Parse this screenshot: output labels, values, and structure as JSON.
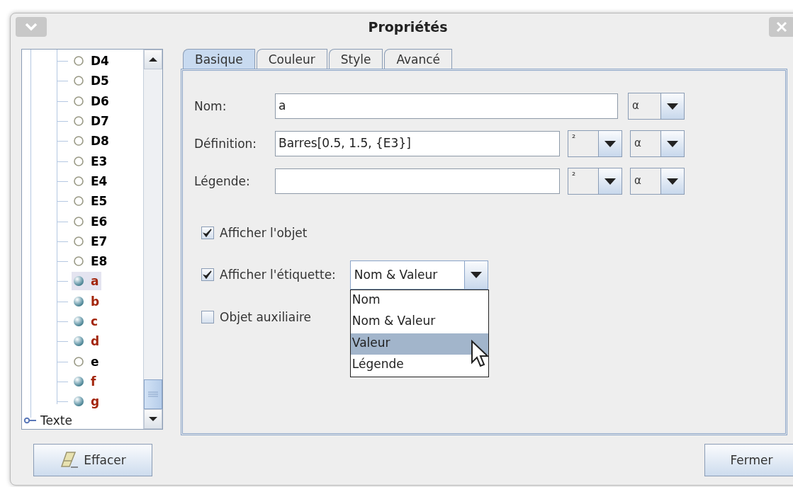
{
  "window": {
    "title": "Propriétés"
  },
  "tree": {
    "items": [
      {
        "label": "D4",
        "visible": false,
        "color": "#000000",
        "selected": false
      },
      {
        "label": "D5",
        "visible": false,
        "color": "#000000",
        "selected": false
      },
      {
        "label": "D6",
        "visible": false,
        "color": "#000000",
        "selected": false
      },
      {
        "label": "D7",
        "visible": false,
        "color": "#000000",
        "selected": false
      },
      {
        "label": "D8",
        "visible": false,
        "color": "#000000",
        "selected": false
      },
      {
        "label": "E3",
        "visible": false,
        "color": "#000000",
        "selected": false
      },
      {
        "label": "E4",
        "visible": false,
        "color": "#000000",
        "selected": false
      },
      {
        "label": "E5",
        "visible": false,
        "color": "#000000",
        "selected": false
      },
      {
        "label": "E6",
        "visible": false,
        "color": "#000000",
        "selected": false
      },
      {
        "label": "E7",
        "visible": false,
        "color": "#000000",
        "selected": false
      },
      {
        "label": "E8",
        "visible": false,
        "color": "#000000",
        "selected": false
      },
      {
        "label": "a",
        "visible": true,
        "color": "#a3260c",
        "selected": true
      },
      {
        "label": "b",
        "visible": true,
        "color": "#a3260c",
        "selected": false
      },
      {
        "label": "c",
        "visible": true,
        "color": "#a3260c",
        "selected": false
      },
      {
        "label": "d",
        "visible": true,
        "color": "#a3260c",
        "selected": false
      },
      {
        "label": "e",
        "visible": false,
        "color": "#000000",
        "selected": false
      },
      {
        "label": "f",
        "visible": true,
        "color": "#a3260c",
        "selected": false
      },
      {
        "label": "g",
        "visible": true,
        "color": "#a3260c",
        "selected": false
      }
    ],
    "groups": [
      {
        "label": "Texte",
        "expanded": false
      }
    ]
  },
  "tabs": [
    {
      "label": "Basique",
      "selected": true
    },
    {
      "label": "Couleur",
      "selected": false
    },
    {
      "label": "Style",
      "selected": false
    },
    {
      "label": "Avancé",
      "selected": false
    }
  ],
  "fields": [
    {
      "label": "Nom:",
      "value": "a",
      "combos": [
        "α"
      ]
    },
    {
      "label": "Définition:",
      "value": "Barres[0.5, 1.5, {E3}]",
      "combos": [
        "²",
        "α"
      ]
    },
    {
      "label": "Légende:",
      "combos": [
        "²",
        "α"
      ]
    }
  ],
  "checkboxes": [
    {
      "label": "Afficher l'objet",
      "checked": true,
      "kind": "plain"
    },
    {
      "label": "Afficher l'étiquette:",
      "checked": true,
      "kind": "dropdown"
    },
    {
      "label": "Objet auxiliaire",
      "checked": false,
      "kind": "plain"
    }
  ],
  "label_dropdown": {
    "value": "Nom & Valeur",
    "expanded": true,
    "options": [
      {
        "label": "Nom",
        "highlighted": false
      },
      {
        "label": "Nom & Valeur",
        "highlighted": false
      },
      {
        "label": "Valeur",
        "highlighted": true
      },
      {
        "label": "Légende",
        "highlighted": false
      }
    ]
  },
  "buttons": {
    "clear": "Effacer",
    "close": "Fermer"
  }
}
